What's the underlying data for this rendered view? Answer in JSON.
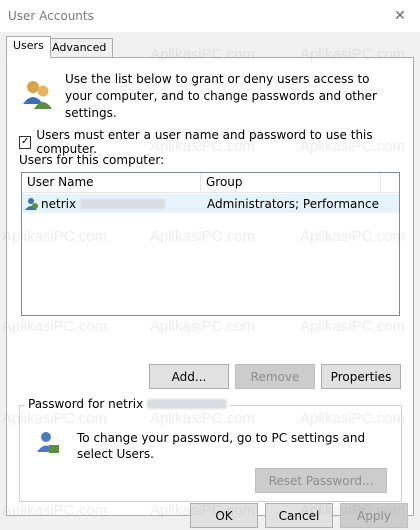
{
  "window": {
    "title": "User Accounts",
    "close_glyph": "✕"
  },
  "tabs": [
    {
      "label": "Users",
      "active": true
    },
    {
      "label": "Advanced",
      "active": false
    }
  ],
  "intro": {
    "text": "Use the list below to grant or deny users access to your computer, and to change passwords and other settings."
  },
  "checkbox": {
    "checked": true,
    "label": "Users must enter a user name and password to use this computer."
  },
  "users_list": {
    "label": "Users for this computer:",
    "columns": [
      "User Name",
      "Group"
    ],
    "rows": [
      {
        "name": "netrix",
        "group": "Administrators; Performance L..."
      }
    ]
  },
  "buttons": {
    "add": "Add...",
    "remove": "Remove",
    "properties": "Properties",
    "reset_password": "Reset Password...",
    "ok": "OK",
    "cancel": "Cancel",
    "apply": "Apply"
  },
  "password_group": {
    "legend": "Password for netrix",
    "text": "To change your password, go to PC settings and select Users."
  },
  "watermark": "AplikasiPC.com",
  "colors": {
    "dialog_bg": "#f0f0f0",
    "selected_row": "#e5f3fb",
    "disabled_button": "#cccccc"
  }
}
